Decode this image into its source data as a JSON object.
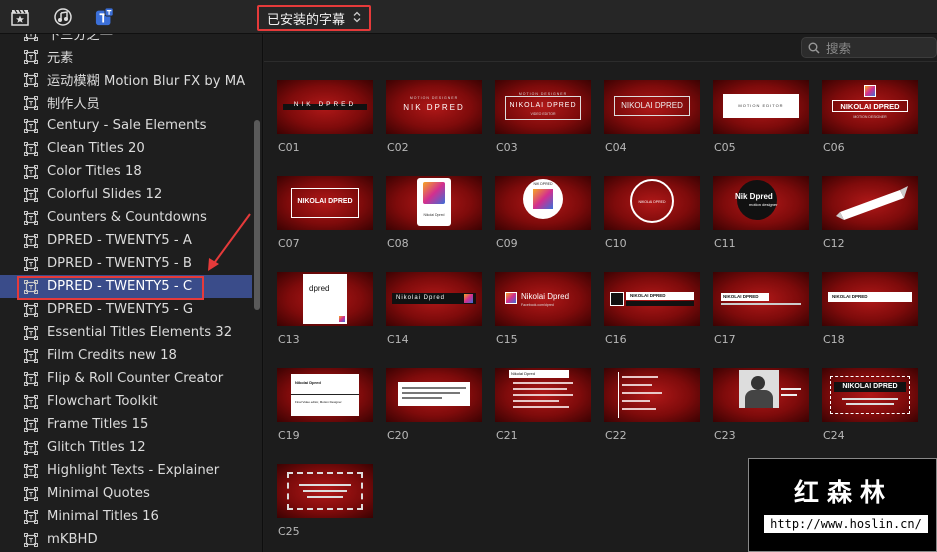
{
  "toolbar": {
    "icons": [
      "clapper-star-icon",
      "music-notes-icon",
      "titles-t-icon"
    ],
    "dropdown_label": "已安装的字幕"
  },
  "sidebar": {
    "items": [
      {
        "label": "下三分之一"
      },
      {
        "label": "元素"
      },
      {
        "label": "运动模糊 Motion Blur FX by MA"
      },
      {
        "label": "制作人员"
      },
      {
        "label": "Century - Sale Elements"
      },
      {
        "label": "Clean Titles 20"
      },
      {
        "label": "Color Titles 18"
      },
      {
        "label": "Colorful Slides 12"
      },
      {
        "label": "Counters & Countdowns"
      },
      {
        "label": "DPRED - TWENTY5 - A"
      },
      {
        "label": "DPRED - TWENTY5 - B"
      },
      {
        "label": "DPRED - TWENTY5 - C",
        "selected": true
      },
      {
        "label": "DPRED - TWENTY5 - G"
      },
      {
        "label": "Essential Titles Elements 32"
      },
      {
        "label": "Film Credits new 18"
      },
      {
        "label": "Flip & Roll Counter Creator"
      },
      {
        "label": "Flowchart Toolkit"
      },
      {
        "label": "Frame Titles 15"
      },
      {
        "label": "Glitch Titles 12"
      },
      {
        "label": "Highlight Texts - Explainer"
      },
      {
        "label": "Minimal Quotes"
      },
      {
        "label": "Minimal Titles 16"
      },
      {
        "label": "mKBHD"
      }
    ]
  },
  "search": {
    "placeholder": "搜索"
  },
  "thumb_text": {
    "c01": "NIK DPRED",
    "c02_small": "MOTION DESIGNER",
    "c02": "NIK DPRED",
    "c03_small": "MOTION DESIGNER",
    "c03": "NIKOLAI DPRED",
    "c03_sub": "VIDEO EDITOR",
    "c04": "NIKOLAI DPRED",
    "c05": "MOTION EDITOR",
    "c06": "NIKOLAI DPRED",
    "c06_sub": "MOTION DESIGNER",
    "c07": "NIKOLAI DPRED",
    "c08": "Nikolai Dpred",
    "c09": "NIK DPRED",
    "c10": "NIKOLAI DPRED",
    "c11": "Nik Dpred",
    "c11_sub": "motion designer",
    "c13": "dpred",
    "c14": "Nikolai Dpred",
    "c15": "Nikolai Dpred",
    "c15_sub": "Facebook.com/dpred",
    "c16": "NIKOLAI DPRED",
    "c17": "NIKOLAI DPRED",
    "c18": "NIKOLAI DPRED",
    "c19": "Nikolai Dpred",
    "c19_sub": "Final Video editor, Motion Designer",
    "c21": "Nikolai Dpred",
    "c24": "NIKOLAI DPRED"
  },
  "tiles": [
    {
      "caption": "C01"
    },
    {
      "caption": "C02"
    },
    {
      "caption": "C03"
    },
    {
      "caption": "C04"
    },
    {
      "caption": "C05"
    },
    {
      "caption": "C06"
    },
    {
      "caption": "C07"
    },
    {
      "caption": "C08"
    },
    {
      "caption": "C09"
    },
    {
      "caption": "C10"
    },
    {
      "caption": "C11"
    },
    {
      "caption": "C12"
    },
    {
      "caption": "C13"
    },
    {
      "caption": "C14"
    },
    {
      "caption": "C15"
    },
    {
      "caption": "C16"
    },
    {
      "caption": "C17"
    },
    {
      "caption": "C18"
    },
    {
      "caption": "C19"
    },
    {
      "caption": "C20"
    },
    {
      "caption": "C21"
    },
    {
      "caption": "C22"
    },
    {
      "caption": "C23"
    },
    {
      "caption": "C24"
    },
    {
      "caption": "C25"
    }
  ],
  "watermark": {
    "title": "红森林",
    "url": "http://www.hoslin.cn/"
  },
  "colors": {
    "selection": "#3a4c8a",
    "highlight_box": "#e53a3a",
    "thumb_red": "#b01818"
  }
}
